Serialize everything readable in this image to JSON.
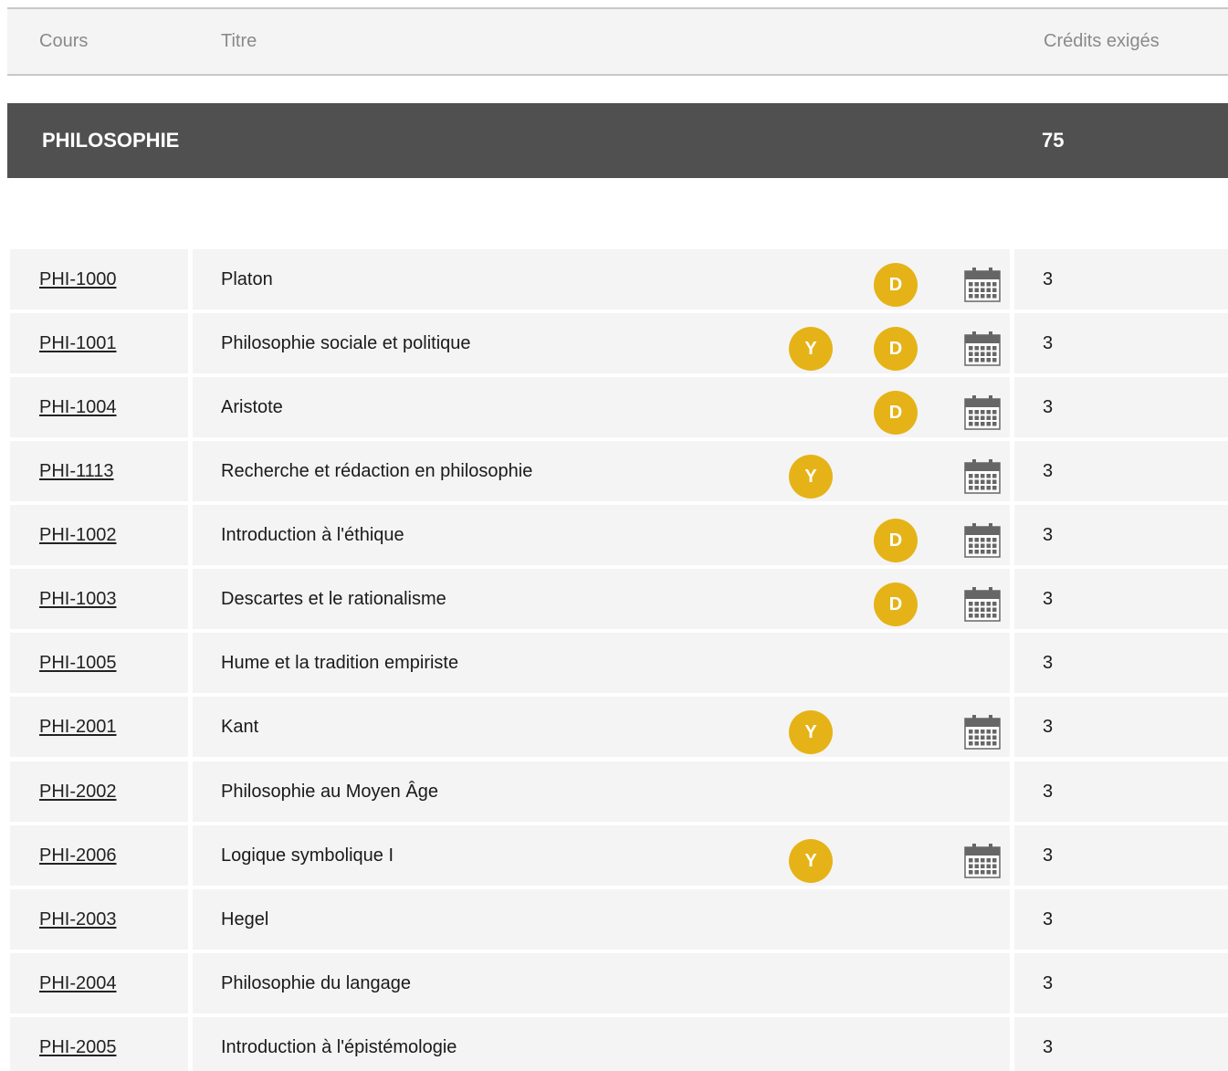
{
  "header": {
    "col_code": "Cours",
    "col_title": "Titre",
    "col_credits": "Crédits exigés"
  },
  "section": {
    "name": "PHILOSOPHIE",
    "credits": "75"
  },
  "icons": {
    "y_badge": "Y",
    "d_badge": "D",
    "calendar": "calendar-icon",
    "badge_color": "#e5b317"
  },
  "courses": [
    {
      "code": "PHI-1000",
      "title": "Platon",
      "credits": "3",
      "y": false,
      "d": true,
      "cal": true
    },
    {
      "code": "PHI-1001",
      "title": "Philosophie sociale et politique",
      "credits": "3",
      "y": true,
      "d": true,
      "cal": true
    },
    {
      "code": "PHI-1004",
      "title": "Aristote",
      "credits": "3",
      "y": false,
      "d": true,
      "cal": true
    },
    {
      "code": "PHI-1113",
      "title": "Recherche et rédaction en philosophie",
      "credits": "3",
      "y": true,
      "d": false,
      "cal": true
    },
    {
      "code": "PHI-1002",
      "title": "Introduction à l'éthique",
      "credits": "3",
      "y": false,
      "d": true,
      "cal": true
    },
    {
      "code": "PHI-1003",
      "title": "Descartes et le rationalisme",
      "credits": "3",
      "y": false,
      "d": true,
      "cal": true
    },
    {
      "code": "PHI-1005",
      "title": "Hume et la tradition empiriste",
      "credits": "3",
      "y": false,
      "d": false,
      "cal": false
    },
    {
      "code": "PHI-2001",
      "title": "Kant",
      "credits": "3",
      "y": true,
      "d": false,
      "cal": true
    },
    {
      "code": "PHI-2002",
      "title": "Philosophie au Moyen Âge",
      "credits": "3",
      "y": false,
      "d": false,
      "cal": false
    },
    {
      "code": "PHI-2006",
      "title": "Logique symbolique I",
      "credits": "3",
      "y": true,
      "d": false,
      "cal": true
    },
    {
      "code": "PHI-2003",
      "title": "Hegel",
      "credits": "3",
      "y": false,
      "d": false,
      "cal": false
    },
    {
      "code": "PHI-2004",
      "title": "Philosophie du langage",
      "credits": "3",
      "y": false,
      "d": false,
      "cal": false
    },
    {
      "code": "PHI-2005",
      "title": "Introduction à l'épistémologie",
      "credits": "3",
      "y": false,
      "d": false,
      "cal": false
    }
  ]
}
